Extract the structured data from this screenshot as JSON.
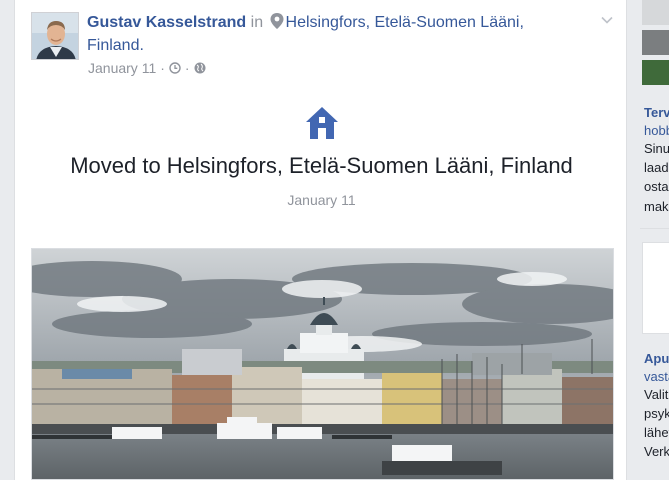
{
  "post": {
    "author": "Gustav Kasselstrand",
    "connector": "in",
    "location": "Helsingfors, Etelä-Suomen Lääni, Finland.",
    "date": "January 11",
    "separator": "·"
  },
  "life_event": {
    "icon": "house-icon",
    "title": "Moved to Helsingfors, Etelä-Suomen Lääni, Finland",
    "date": "January 11"
  },
  "right_column": {
    "ad1": {
      "title": "Terv",
      "link": "hobb",
      "lines": [
        "Sinu",
        "laadi",
        "ostar",
        "maks"
      ]
    },
    "ad2": {
      "title": "Apu",
      "link": "vasta",
      "lines": [
        "Valit",
        "psyk",
        "lähet",
        "Verk"
      ]
    }
  },
  "colors": {
    "link": "#365899",
    "meta": "#90949c",
    "text": "#1d2129",
    "background": "#e9ebee"
  }
}
